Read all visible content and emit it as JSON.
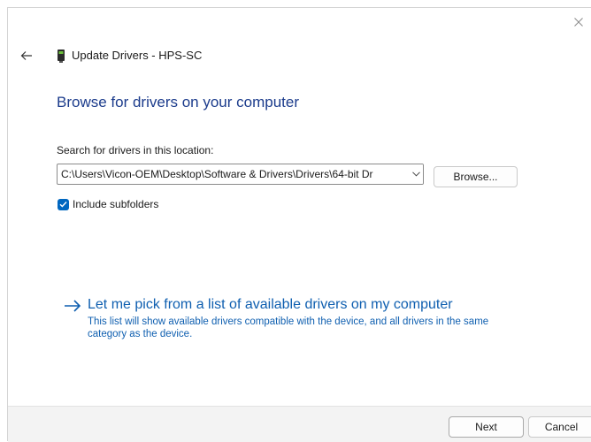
{
  "window": {
    "title": "Update Drivers - HPS-SC"
  },
  "content": {
    "heading": "Browse for drivers on your computer",
    "search_label": "Search for drivers in this location:",
    "path_value": "C:\\Users\\Vicon-OEM\\Desktop\\Software & Drivers\\Drivers\\64-bit Dr",
    "browse_label": "Browse...",
    "include_subfolders_label": "Include subfolders",
    "include_subfolders_checked": true,
    "pick_link_title": "Let me pick from a list of available drivers on my computer",
    "pick_link_desc": "This list will show available drivers compatible with the device, and all drivers in the same category as the device."
  },
  "footer": {
    "next_label": "Next",
    "cancel_label": "Cancel"
  },
  "icons": {
    "close": "close-icon",
    "back": "back-arrow-icon",
    "device": "device-icon",
    "combo": "chevron-down-icon",
    "checkbox": "checkmark-icon",
    "link": "right-arrow-icon"
  },
  "colors": {
    "accent": "#0067c0",
    "heading": "#1c3c8c",
    "link": "#0f5fb0",
    "footer_bg": "#f3f3f3"
  }
}
